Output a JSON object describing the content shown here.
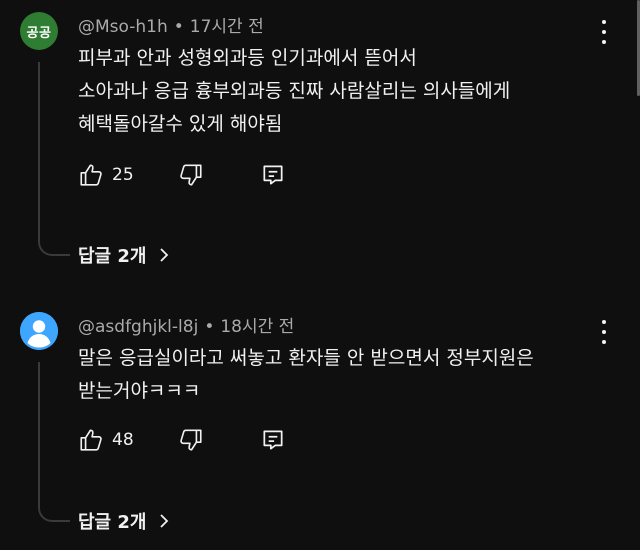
{
  "comments": [
    {
      "avatar_text": "공공",
      "avatar_color": "#2e7d32",
      "author": "@Mso-h1h",
      "time": "17시간 전",
      "lines": [
        "피부과 안과 성형외과등 인기과에서 뜯어서",
        "소아과나 응급 흉부외과등 진짜 사람살리는 의사들에게",
        "혜택돌아갈수 있게 해야됨"
      ],
      "likes": "25",
      "replies_label": "답글 2개"
    },
    {
      "avatar_text": "",
      "avatar_color": "#3ea6ff",
      "author": "@asdfghjkl-l8j",
      "time": "18시간 전",
      "lines": [
        "말은 응급실이라고 써놓고 환자들 안 받으면서 정부지원은",
        "받는거야ㅋㅋㅋ"
      ],
      "likes": "48",
      "replies_label": "답글 2개"
    }
  ],
  "icons": {
    "like": "thumbs-up-icon",
    "dislike": "thumbs-down-icon",
    "reply": "reply-comment-icon",
    "menu": "more-vertical-icon",
    "expand": "chevron-right-icon",
    "default_avatar": "default-user-icon"
  },
  "colors": {
    "background": "#0f0f0f",
    "text": "#f1f1f1",
    "meta": "#aaaaaa"
  }
}
